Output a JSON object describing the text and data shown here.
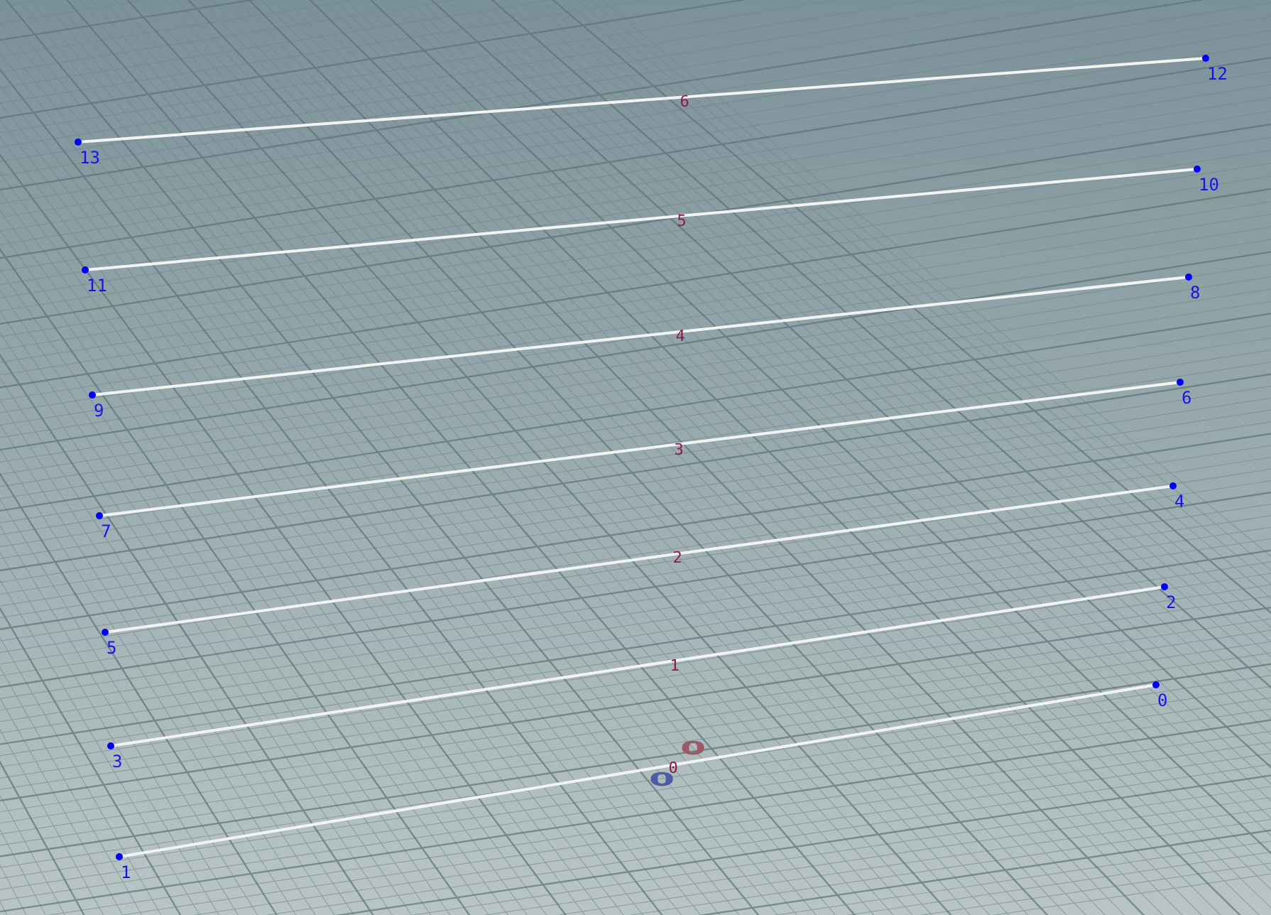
{
  "viewport": {
    "primitives": [
      {
        "number": "6",
        "points": [
          {
            "number": "13"
          },
          {
            "number": "12"
          }
        ]
      },
      {
        "number": "5",
        "points": [
          {
            "number": "11"
          },
          {
            "number": "10"
          }
        ]
      },
      {
        "number": "4",
        "points": [
          {
            "number": "9"
          },
          {
            "number": "8"
          }
        ]
      },
      {
        "number": "3",
        "points": [
          {
            "number": "7"
          },
          {
            "number": "6"
          }
        ]
      },
      {
        "number": "2",
        "points": [
          {
            "number": "5"
          },
          {
            "number": "4"
          }
        ]
      },
      {
        "number": "1",
        "points": [
          {
            "number": "3"
          },
          {
            "number": "2"
          }
        ]
      },
      {
        "number": "0",
        "points": [
          {
            "number": "1"
          },
          {
            "number": "0"
          }
        ]
      }
    ],
    "grid_labels": [
      {
        "text": "0",
        "color": "#9a5a66"
      },
      {
        "text": "0",
        "color": "#4e5ca4"
      }
    ]
  }
}
